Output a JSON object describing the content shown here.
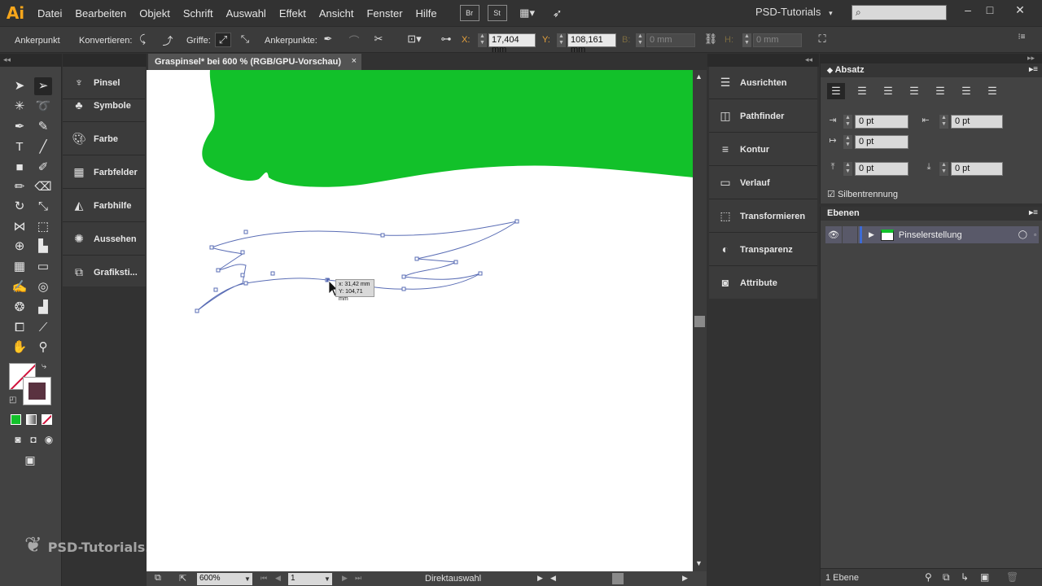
{
  "app": {
    "logo": "Ai"
  },
  "menu": [
    "Datei",
    "Bearbeiten",
    "Objekt",
    "Schrift",
    "Auswahl",
    "Effekt",
    "Ansicht",
    "Fenster",
    "Hilfe"
  ],
  "menu_buttons": [
    "Br",
    "St"
  ],
  "workspace": {
    "label": "PSD-Tutorials",
    "caret": "▾"
  },
  "control_bar": {
    "mode": "Ankerpunkt",
    "convert_label": "Konvertieren:",
    "handles_label": "Griffe:",
    "anchors_label": "Ankerpunkte:",
    "x_letter": "X:",
    "x_value": "17,404 mm",
    "y_letter": "Y:",
    "y_value": "108,161 mm",
    "w_letter": "B:",
    "w_value": "0 mm",
    "h_letter": "H:",
    "h_value": "0 mm"
  },
  "document": {
    "tab_title": "Graspinsel* bei 600 % (RGB/GPU-Vorschau)",
    "tab_close": "×",
    "tooltip_x": "x: 31,42 mm",
    "tooltip_y": "Y: 104,71 mm",
    "fill_color": "#12c12a"
  },
  "status_bar": {
    "zoom": "600%",
    "artboard": "1",
    "tool_name": "Direktauswahl"
  },
  "left_dock": [
    {
      "label": "Pinsel",
      "icon": "brush-icon"
    },
    {
      "label": "Symbole",
      "icon": "club-icon"
    },
    {
      "label": "Farbe",
      "icon": "palette-icon"
    },
    {
      "label": "Farbfelder",
      "icon": "swatches-icon"
    },
    {
      "label": "Farbhilfe",
      "icon": "color-guide-icon"
    },
    {
      "label": "Aussehen",
      "icon": "appearance-icon"
    },
    {
      "label": "Grafiksti...",
      "icon": "graphic-styles-icon"
    }
  ],
  "right_dock": [
    {
      "label": "Ausrichten",
      "icon": "align-icon"
    },
    {
      "label": "Pathfinder",
      "icon": "pathfinder-icon"
    },
    {
      "label": "Kontur",
      "icon": "stroke-icon"
    },
    {
      "label": "Verlauf",
      "icon": "gradient-icon"
    },
    {
      "label": "Transformieren",
      "icon": "transform-icon"
    },
    {
      "label": "Transparenz",
      "icon": "transparency-icon"
    },
    {
      "label": "Attribute",
      "icon": "attributes-icon"
    }
  ],
  "absatz": {
    "title": "Absatz",
    "left_indent": "0 pt",
    "right_indent": "0 pt",
    "first_line_indent": "0 pt",
    "space_before": "0 pt",
    "space_after": "0 pt",
    "hyphenation_label": "Silbentrennung",
    "hyphenation_checked": true
  },
  "ebenen": {
    "title": "Ebenen",
    "layer_name": "Pinselerstellung",
    "layer_color": "#3d6bd6",
    "count_label": "1 Ebene"
  },
  "watermark": "PSD-Tutorials.de"
}
